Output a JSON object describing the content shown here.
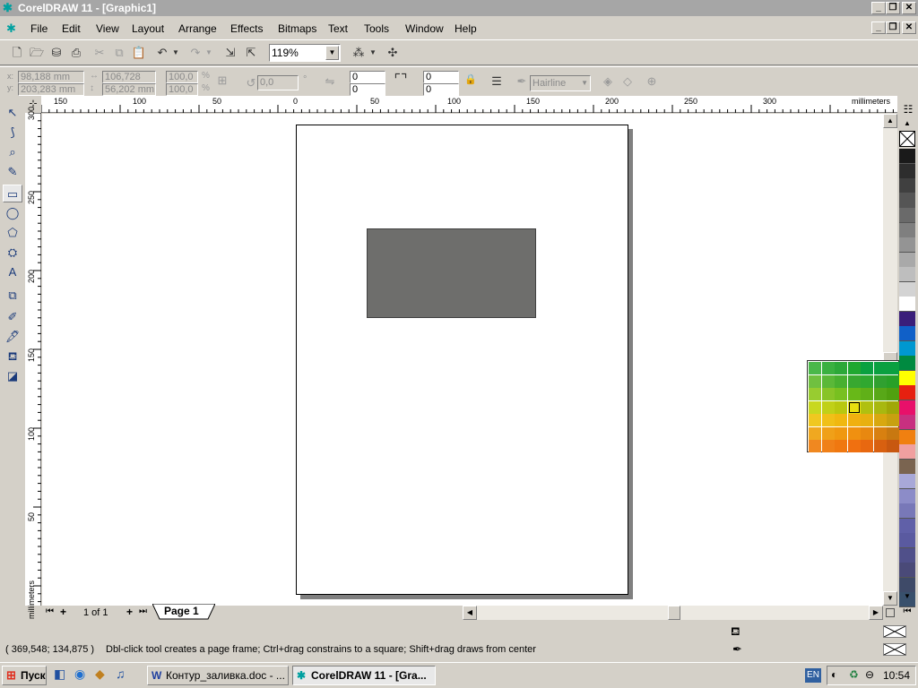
{
  "window": {
    "title": "CorelDRAW 11 - [Graphic1]"
  },
  "menu": {
    "items": [
      "File",
      "Edit",
      "View",
      "Layout",
      "Arrange",
      "Effects",
      "Bitmaps",
      "Text",
      "Tools",
      "Window",
      "Help"
    ]
  },
  "standard_toolbar": {
    "zoom_value": "119%"
  },
  "property_bar": {
    "x_pos": "98,188 mm",
    "y_pos": "203,283 mm",
    "width": "106,728 mm",
    "height": "56,202 mm",
    "scale_w": "100,0",
    "scale_h": "100,0",
    "percent": "%",
    "rotation": "0,0",
    "degree": "°",
    "corner_1": "0",
    "corner_2": "0",
    "corner_3": "0",
    "corner_4": "0",
    "outline_width": "Hairline"
  },
  "rulers": {
    "unit": "millimeters",
    "h_ticks": [
      "150",
      "100",
      "50",
      "0",
      "50",
      "100",
      "150",
      "200",
      "250",
      "300"
    ],
    "v_ticks": [
      "300",
      "250",
      "200",
      "150",
      "100",
      "50"
    ]
  },
  "page_nav": {
    "count": "1 of 1",
    "tab_label": "Page 1"
  },
  "status": {
    "coordinates": "( 369,548; 134,875 )",
    "hint": "Dbl-click tool creates a page frame; Ctrl+drag constrains to a square; Shift+drag draws from center"
  },
  "taskbar": {
    "start_label": "Пуск",
    "task1": "Контур_заливка.doc - ...",
    "task2": "CorelDRAW 11 - [Gra...",
    "lang": "EN",
    "clock": "10:54"
  },
  "colors": {
    "rectangle_fill": "#6e6e6c",
    "accent": "#0a246a"
  },
  "palette_colors": [
    "#ffffff",
    "#1a1a1a",
    "#2d2d2d",
    "#404040",
    "#555555",
    "#6a6a6a",
    "#7f7f7f",
    "#949494",
    "#a9a9a9",
    "#bebebe",
    "#d3d3d3",
    "#ffffff",
    "#3a1e7a",
    "#1060c8",
    "#0098d0",
    "#008a40",
    "#ffff00",
    "#e62010",
    "#e8106a",
    "#c83080",
    "#f08010",
    "#f0a0a0",
    "#7a6450",
    "#a8a8d8",
    "#8c8cc8",
    "#7878b8",
    "#6060a8",
    "#5a5aa0",
    "#50508a",
    "#4a4a78",
    "#3e4a68",
    "#38506c"
  ],
  "popup_colors": [
    [
      "#4ab84a",
      "#3ab040",
      "#2ca838",
      "#20a830",
      "#0aa040",
      "#0aa040",
      "#0aa040"
    ],
    [
      "#70c040",
      "#5ab838",
      "#48b030",
      "#38a830",
      "#30a830",
      "#30a030",
      "#28a028"
    ],
    [
      "#98cc30",
      "#88c428",
      "#78c020",
      "#68b818",
      "#60b018",
      "#58a818",
      "#50a010"
    ],
    [
      "#c8d820",
      "#c0d018",
      "#b8c810",
      "#e8e010",
      "#b0c010",
      "#a8b810",
      "#a0a808"
    ],
    [
      "#f0c820",
      "#f0c018",
      "#f0b810",
      "#f0b010",
      "#e8b010",
      "#d8a810",
      "#c8a010"
    ],
    [
      "#f0a820",
      "#f0a018",
      "#f09810",
      "#f09010",
      "#e88810",
      "#d88010",
      "#c87810"
    ],
    [
      "#f08820",
      "#f08018",
      "#f07810",
      "#f07010",
      "#e86810",
      "#d86010",
      "#c85810"
    ]
  ]
}
